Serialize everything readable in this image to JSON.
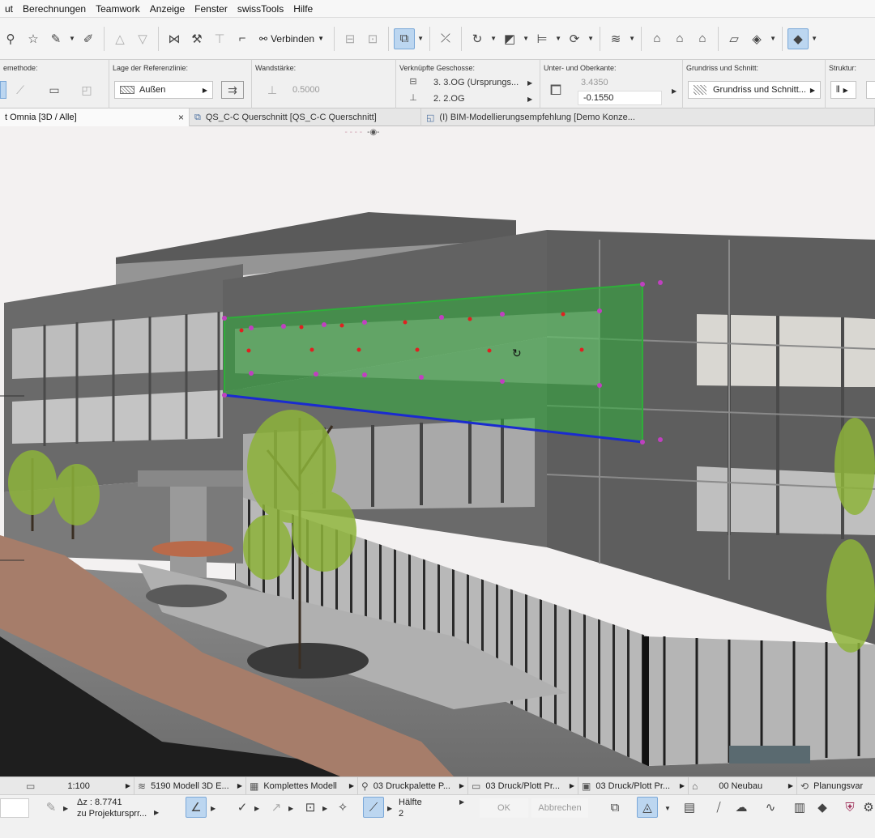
{
  "menu": [
    "ut",
    "Berechnungen",
    "Teamwork",
    "Anzeige",
    "Fenster",
    "swissTools",
    "Hilfe"
  ],
  "toolbar": {
    "connect_label": "Verbinden"
  },
  "infobox": {
    "method_label": "emethode:",
    "refline_label": "Lage der Referenzlinie:",
    "refline_value": "Außen",
    "thickness_label": "Wandstärke:",
    "thickness_value": "0.5000",
    "stories_label": "Verknüpfte Geschosse:",
    "story_top": "3. 3.OG (Ursprungs...",
    "story_bottom": "2. 2.OG",
    "elev_label": "Unter- und Oberkante:",
    "elev_top": "3.4350",
    "elev_bottom": "-0.1550",
    "plan_label": "Grundriss und Schnitt:",
    "plan_value": "Grundriss und Schnitt...",
    "structure_label": "Struktur:"
  },
  "tabs": [
    {
      "label": "t Omnia [3D / Alle]",
      "close": "×"
    },
    {
      "label": "QS_C-C Querschnitt [QS_C-C Querschnitt]"
    },
    {
      "label": "(I) BIM-Modellierungsempfehlung [Demo Konze..."
    }
  ],
  "statusbar": {
    "scale": "1:100",
    "view": "5190 Modell 3D E...",
    "model": "Komplettes Modell",
    "pen_set": "03 Druckpalette P...",
    "print1": "03 Druck/Plott Pr...",
    "print2": "03 Druck/Plott Pr...",
    "renovation": "00 Neubau",
    "planning": "Planungsvar"
  },
  "bottombar": {
    "dz": "Δz : 8.7741",
    "project": "zu Projektursprr...",
    "half": "Hälfte",
    "half_num": "2",
    "ok": "OK",
    "cancel": "Abbrechen"
  },
  "colors": {
    "accent": "#bcd6f0",
    "selection": "#2fae3a",
    "ref_line": "#1a2bd0"
  }
}
